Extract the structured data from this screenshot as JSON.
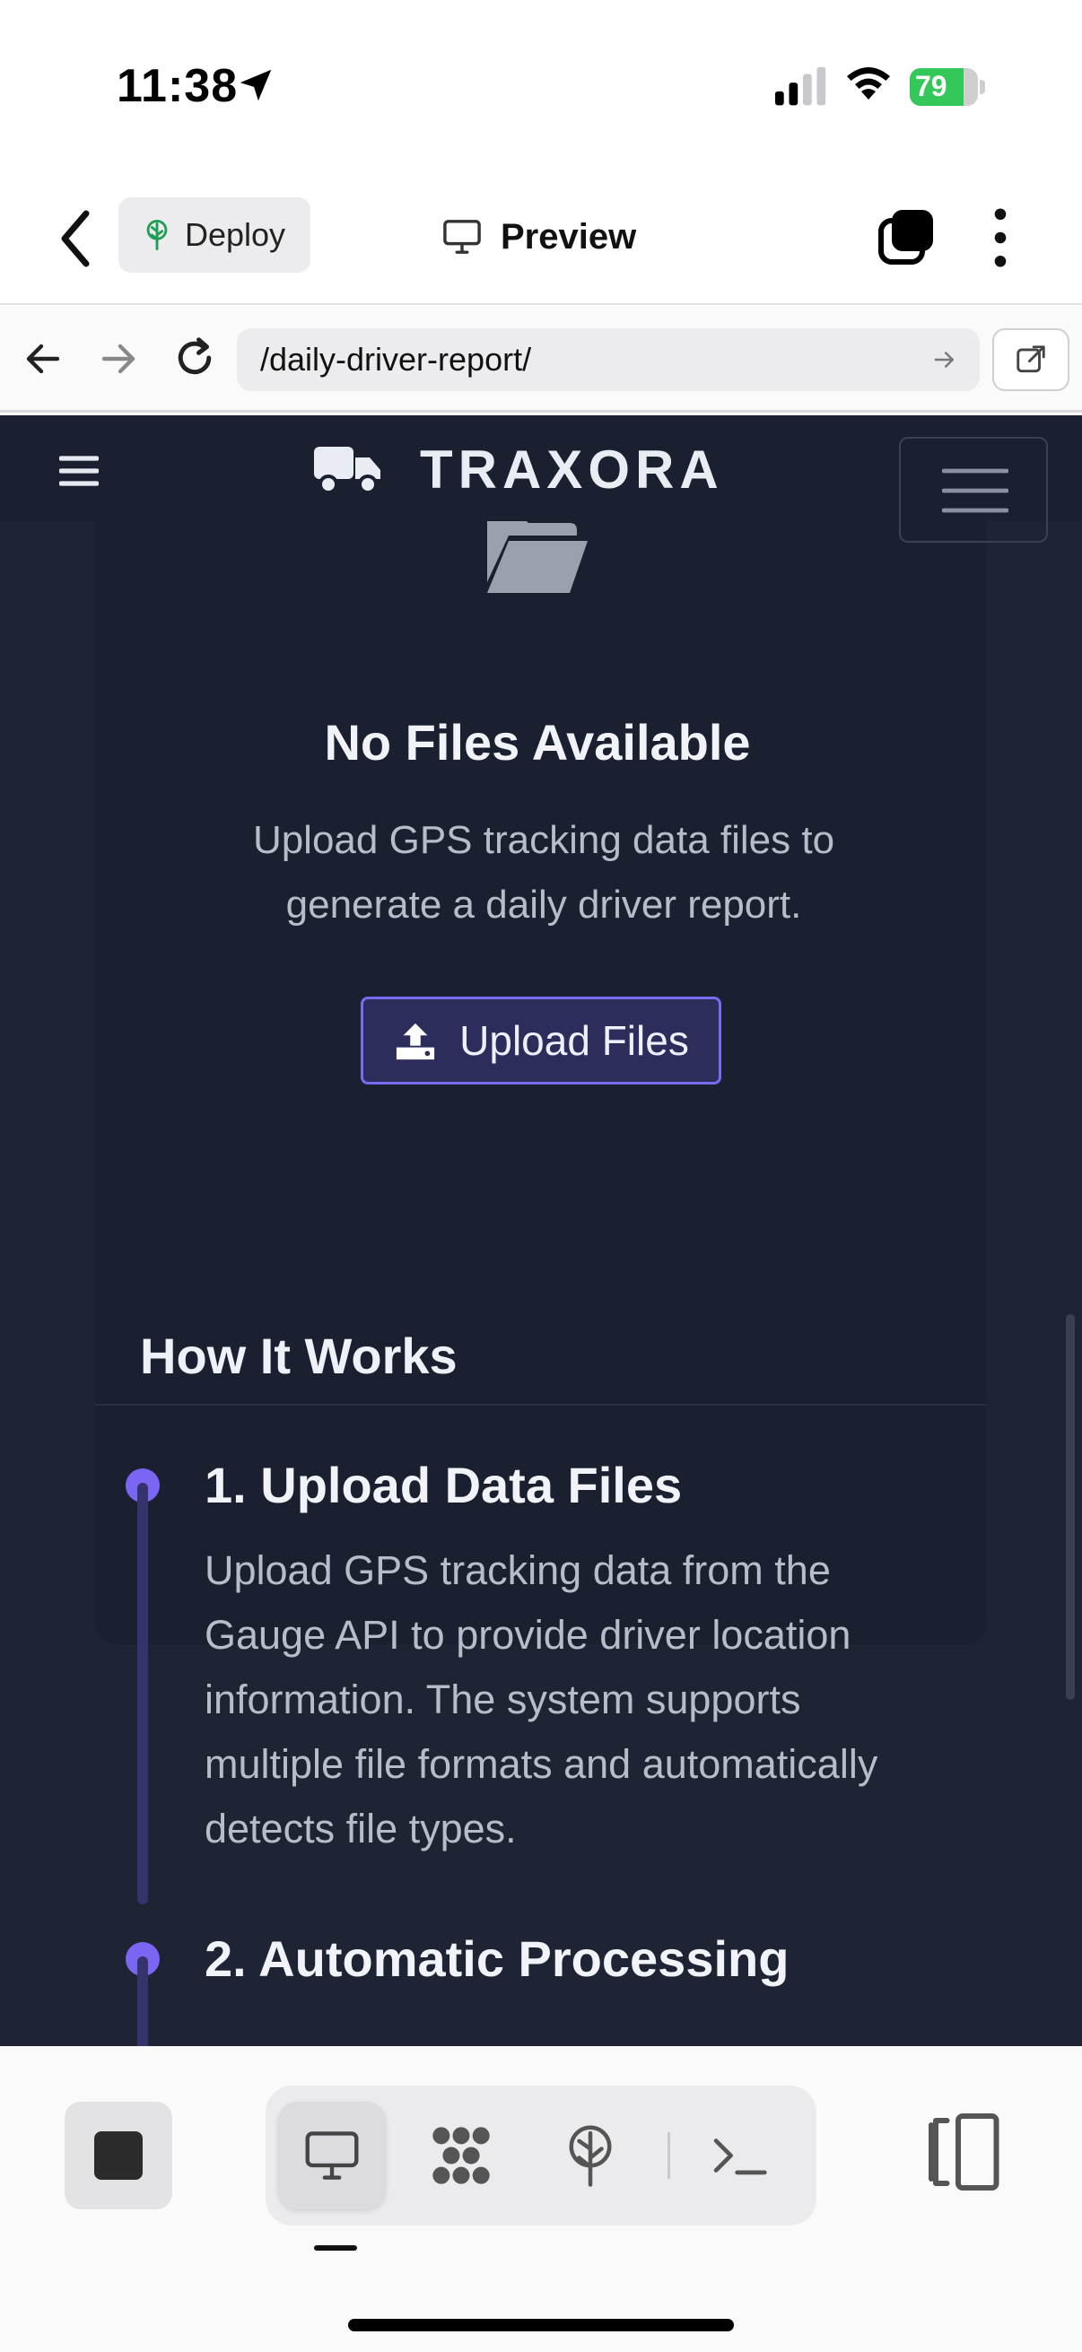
{
  "status_bar": {
    "time": "11:38",
    "battery_percent": "79",
    "battery_level": 0.79,
    "charging": true
  },
  "app_bar": {
    "deploy_label": "Deploy",
    "preview_label": "Preview"
  },
  "browser": {
    "url": "/daily-driver-report/"
  },
  "site": {
    "brand": "TRAXORA"
  },
  "empty_state": {
    "title": "No Files Available",
    "description": "Upload GPS tracking data files to generate a daily driver report.",
    "upload_button": "Upload Files"
  },
  "how_it_works": {
    "title": "How It Works",
    "steps": [
      {
        "title": "1. Upload Data Files",
        "description": "Upload GPS tracking data from the Gauge API to provide driver location information. The system supports multiple file formats and automatically detects file types."
      },
      {
        "title": "2. Automatic Processing",
        "description": ""
      }
    ]
  },
  "colors": {
    "page_bg": "#1f2434",
    "nav_bg": "#1b2030",
    "accent": "#7a66f2",
    "battery_green": "#34c759"
  },
  "icons": {
    "location": "location-arrow-icon",
    "signal": "cellular-signal-icon",
    "wifi": "wifi-icon",
    "battery": "battery-charging-icon",
    "back": "chevron-left-icon",
    "deploy": "tree-icon",
    "preview": "monitor-icon",
    "tabs": "tabs-icon",
    "more": "more-vertical-icon",
    "folder": "folder-open-icon",
    "upload": "upload-icon",
    "truck": "truck-icon"
  }
}
